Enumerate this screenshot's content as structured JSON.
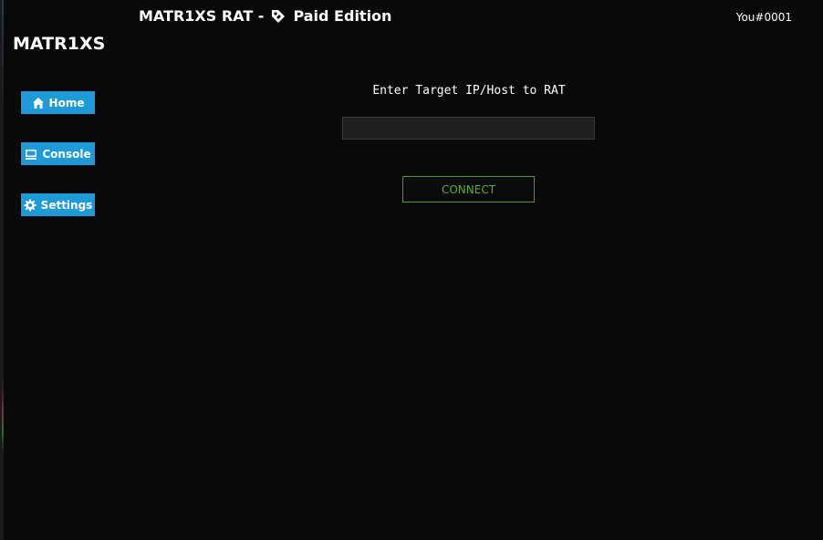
{
  "header": {
    "app_title": "MATR1XS RAT -",
    "edition": "Paid Edition",
    "edition_icon": "price-tag-icon",
    "user_id": "You#0001"
  },
  "sidebar": {
    "brand": "MATR1XS",
    "items": [
      {
        "label": "Home",
        "icon": "home-icon"
      },
      {
        "label": "Console",
        "icon": "console-icon"
      },
      {
        "label": "Settings",
        "icon": "gear-icon"
      }
    ]
  },
  "main": {
    "prompt": "Enter Target IP/Host to RAT",
    "target_input": {
      "value": "",
      "placeholder": ""
    },
    "connect_label": "CONNECT"
  },
  "colors": {
    "background": "#090909",
    "nav_button": "#1e9ad6",
    "connect_accent": "#5eae34"
  }
}
